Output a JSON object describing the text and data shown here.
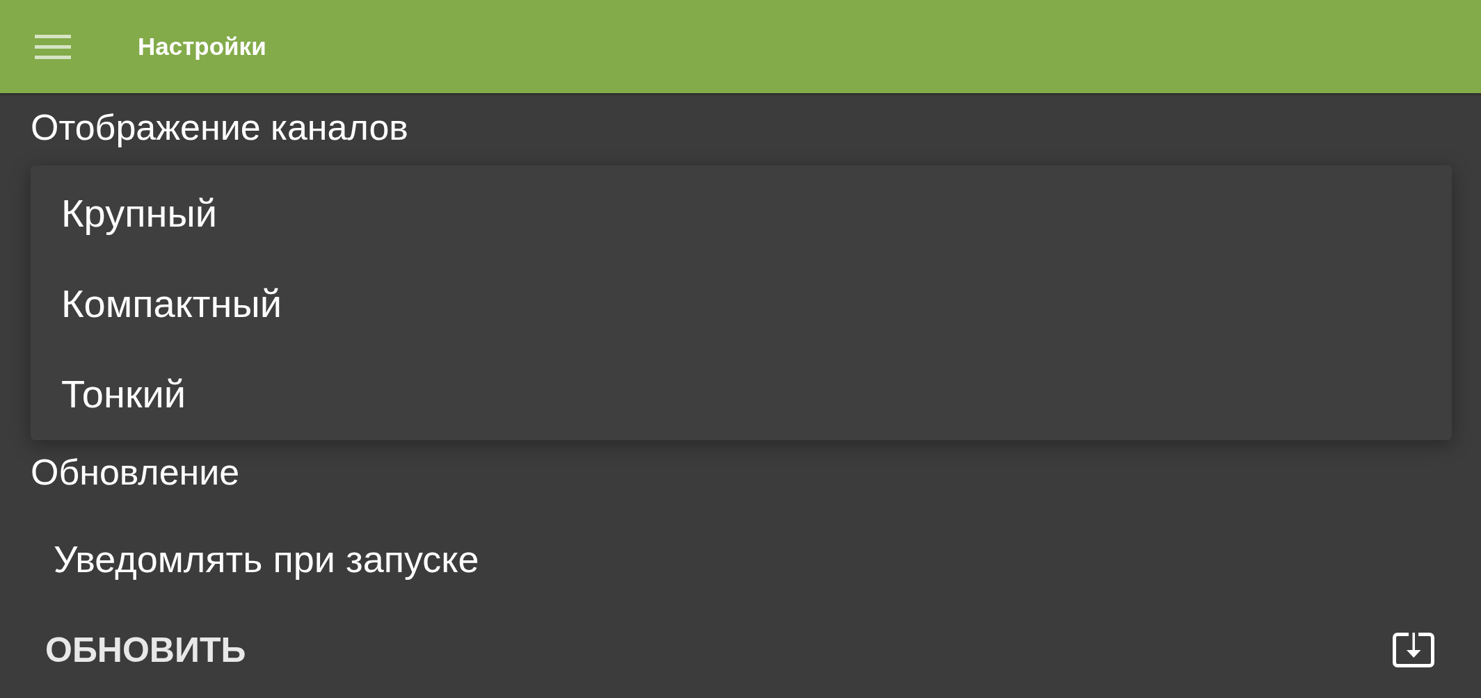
{
  "app_bar": {
    "title": "Настройки"
  },
  "sections": [
    {
      "title": "Отображение каналов",
      "dropdown": {
        "options": [
          "Крупный",
          "Компактный",
          "Тонкий"
        ]
      }
    },
    {
      "title": "Обновление",
      "items": [
        "Уведомлять при запуске"
      ]
    }
  ],
  "bottom_bar": {
    "button_label": "ОБНОВИТЬ"
  }
}
